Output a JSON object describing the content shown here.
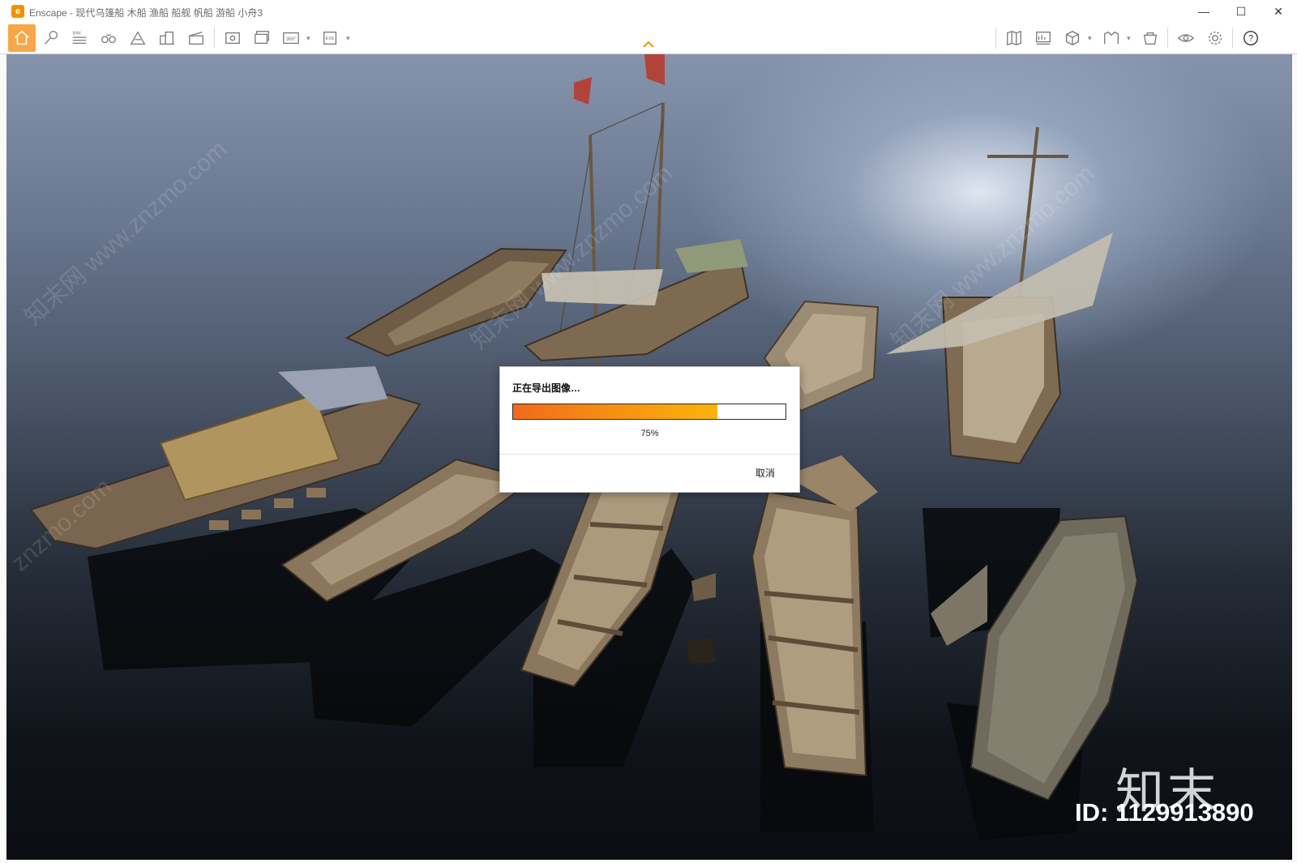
{
  "window": {
    "app_logo": "e",
    "title": "Enscape - 现代乌篷船 木船 渔船 船舰 帆船 游船 小舟3",
    "minimize_glyph": "—",
    "maximize_glyph": "☐",
    "close_glyph": "✕"
  },
  "toolbar": {
    "accent_color": "#f7a74a",
    "left_tools": [
      "home-icon",
      "pin-icon",
      "bim-icon",
      "binoculars-icon",
      "terrain-icon",
      "buildings-icon",
      "clapper-icon",
      "screenshot-icon",
      "batch-render-icon",
      "panorama-360-icon",
      "export-exe-icon"
    ],
    "right_tools": [
      "map-icon",
      "presentation-icon",
      "cube-icon",
      "vr-icon",
      "asset-library-icon",
      "visibility-eye-icon",
      "settings-gear-icon",
      "help-icon"
    ],
    "bim_label": "BIM",
    "panorama_label": "360°",
    "exe_label": "EXE",
    "help_glyph": "?"
  },
  "dialog": {
    "title": "正在导出图像…",
    "progress": 0.75,
    "percent_label": "75%",
    "cancel_label": "取消"
  },
  "watermark": {
    "logo_text": "知末",
    "id_text": "ID: 1129913890",
    "diagonal_text": "知末网 www.znzmo.com",
    "corner_text": "znzmo.com"
  }
}
